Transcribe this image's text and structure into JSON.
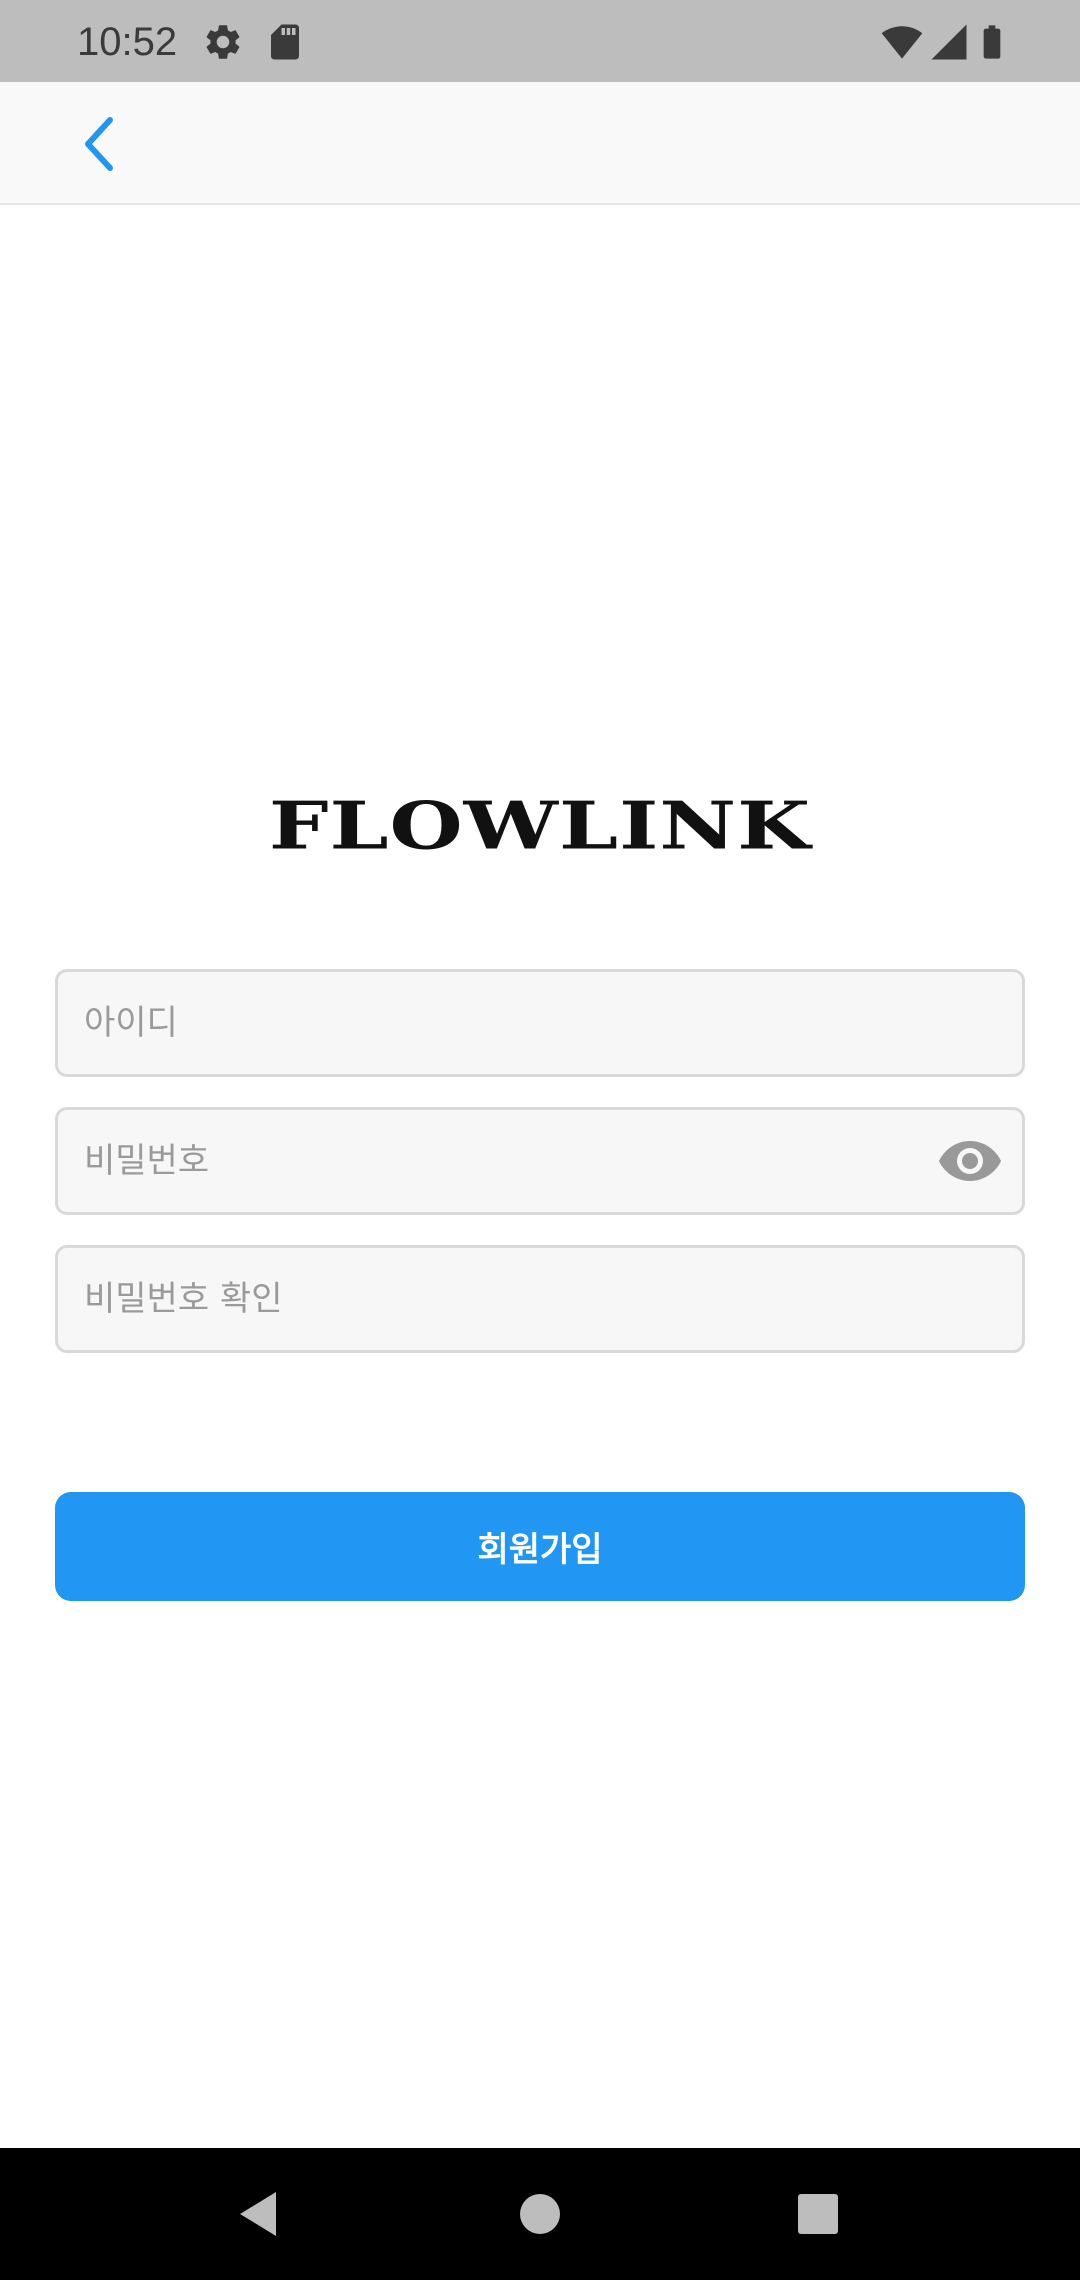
{
  "status_bar": {
    "time": "10:52",
    "icons": [
      "settings-icon",
      "sd-card-icon",
      "wifi-icon",
      "cell-signal-icon",
      "battery-icon"
    ]
  },
  "app_bar": {
    "back_icon": "chevron-left-icon",
    "accent_color": "#2196f3"
  },
  "logo": {
    "text": "FLOWLINK"
  },
  "form": {
    "username": {
      "placeholder": "아이디",
      "value": ""
    },
    "password": {
      "placeholder": "비밀번호",
      "value": "",
      "toggle_icon": "eye-icon"
    },
    "password_confirm": {
      "placeholder": "비밀번호 확인",
      "value": ""
    },
    "submit_label": "회원가입"
  },
  "nav_bar": {
    "items": [
      "back-triangle-icon",
      "home-circle-icon",
      "recents-square-icon"
    ]
  }
}
